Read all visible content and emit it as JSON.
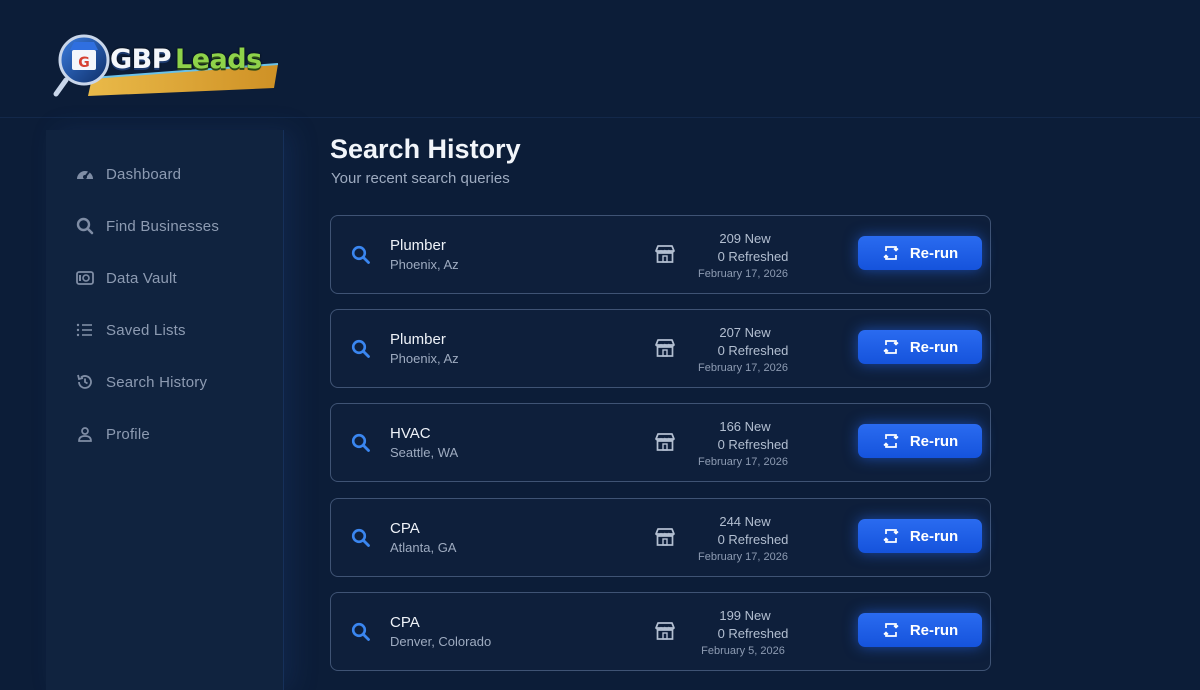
{
  "brand": {
    "part1": "GBP",
    "part2": "Leads"
  },
  "sidebar": {
    "items": [
      {
        "label": "Dashboard",
        "icon": "dashboard-gauge-icon"
      },
      {
        "label": "Find Businesses",
        "icon": "search-icon"
      },
      {
        "label": "Data Vault",
        "icon": "vault-icon"
      },
      {
        "label": "Saved Lists",
        "icon": "list-icon"
      },
      {
        "label": "Search History",
        "icon": "history-icon"
      },
      {
        "label": "Profile",
        "icon": "user-icon"
      }
    ]
  },
  "main": {
    "title": "Search History",
    "subtitle": "Your recent search queries",
    "rerun_label": "Re-run",
    "rows": [
      {
        "query": "Plumber",
        "location": "Phoenix, Az",
        "new": "209 New",
        "refreshed": "0 Refreshed",
        "date": "February 17, 2026"
      },
      {
        "query": "Plumber",
        "location": "Phoenix, Az",
        "new": "207 New",
        "refreshed": "0 Refreshed",
        "date": "February 17, 2026"
      },
      {
        "query": "HVAC",
        "location": "Seattle, WA",
        "new": "166 New",
        "refreshed": "0 Refreshed",
        "date": "February 17, 2026"
      },
      {
        "query": "CPA",
        "location": "Atlanta, GA",
        "new": "244 New",
        "refreshed": "0 Refreshed",
        "date": "February 17, 2026"
      },
      {
        "query": "CPA",
        "location": "Denver, Colorado",
        "new": "199 New",
        "refreshed": "0 Refreshed",
        "date": "February 5, 2026"
      }
    ]
  },
  "colors": {
    "background": "#0c1d38",
    "accent": "#1f5fe8",
    "brand_green": "#8fd34a"
  }
}
